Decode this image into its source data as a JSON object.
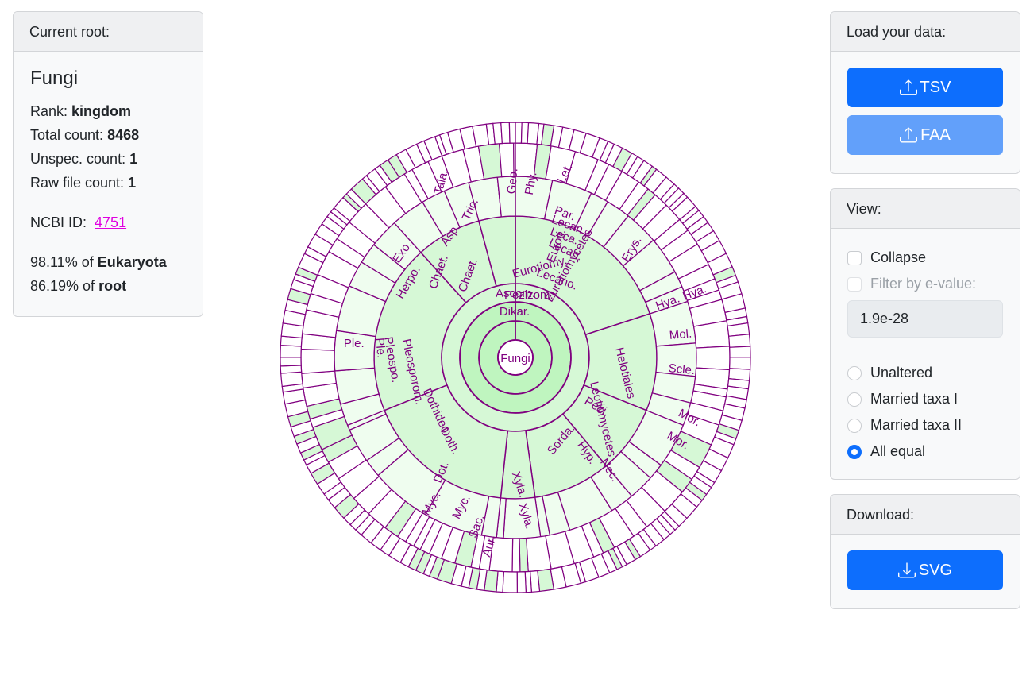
{
  "info": {
    "header": "Current root:",
    "name": "Fungi",
    "rank_label": "Rank:",
    "rank": "kingdom",
    "total_label": "Total count:",
    "total": "8468",
    "unspec_label": "Unspec. count:",
    "unspec": "1",
    "raw_label": "Raw file count:",
    "raw": "1",
    "ncbi_label": "NCBI ID:",
    "ncbi_id": "4751",
    "pct1": "98.11% of",
    "pct1_of": "Eukaryota",
    "pct2": "86.19% of",
    "pct2_of": "root"
  },
  "load": {
    "header": "Load your data:",
    "tsv": "TSV",
    "faa": "FAA"
  },
  "view": {
    "header": "View:",
    "collapse": "Collapse",
    "filter": "Filter by e-value:",
    "evalue": "1.9e-28",
    "options": [
      "Unaltered",
      "Married taxa I",
      "Married taxa II",
      "All equal"
    ],
    "selected": "All equal"
  },
  "download": {
    "header": "Download:",
    "svg": "SVG"
  },
  "sunburst": {
    "center": "Fungi",
    "colors": {
      "stroke": "#800080",
      "fill": "#d6f8d6",
      "fill_light": "#effdef",
      "fill_dark": "#bff5bf"
    },
    "labels": [
      "Dikar.",
      "Ascom.",
      "Pezizom.",
      "Leotiomycetes",
      "Helotiales",
      "Eurotiomycetes",
      "Eurotiomy.",
      "Euroti.",
      "Lecano.",
      "Lecan.",
      "Leca.",
      "Lecan.",
      "Par.",
      "Let.",
      "Phy.",
      "Geo.",
      "Tric.",
      "Tala.",
      "Asp.",
      "Exo.",
      "Herpo.",
      "Chaet.",
      "Chaet.",
      "Ple.",
      "Ple.",
      "Pleospo.",
      "Pleosporom.",
      "Dothideo.",
      "Doth.",
      "Dot.",
      "Myc.",
      "Myc.",
      "Sac.",
      "Aur.",
      "Sorda.",
      "Hyp.",
      "Nec.",
      "Xyla.",
      "Xyla.",
      "Pezi.",
      "Mor.",
      "Mor.",
      "Scle.",
      "Mol.",
      "Hya.",
      "Hya.",
      "Erys."
    ]
  }
}
